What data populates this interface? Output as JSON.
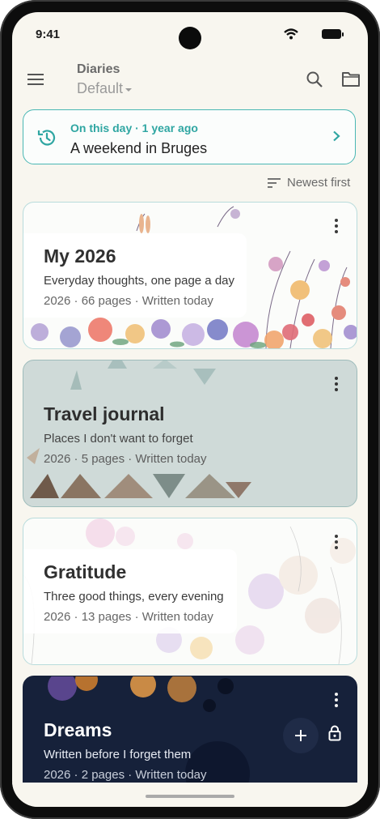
{
  "status_bar": {
    "time": "9:41"
  },
  "top_bar": {
    "label": "Diaries",
    "selected_collection": "Default"
  },
  "on_this_day": {
    "kicker": "On this day · 1 year ago",
    "title": "A weekend in Bruges"
  },
  "sort": {
    "label": "Newest first"
  },
  "diaries": [
    {
      "title": "My 2026",
      "description": "Everyday thoughts, one page a day",
      "meta": "2026 · 66 pages · Written today",
      "theme": "floral"
    },
    {
      "title": "Travel journal",
      "description": "Places I don't want to forget",
      "meta": "2026 · 5 pages · Written today",
      "theme": "geometric"
    },
    {
      "title": "Gratitude",
      "description": "Three good things, every evening",
      "meta": "2026 · 13 pages · Written today",
      "theme": "watercolor"
    },
    {
      "title": "Dreams",
      "description": "Written before I forget them",
      "meta": "2026 · 2 pages · Written today",
      "theme": "space",
      "locked": true
    }
  ],
  "icons": {
    "menu": "menu-icon",
    "search": "search-icon",
    "folder": "folder-icon",
    "history": "history-icon",
    "chevron": "chevron-right-icon",
    "sort": "sort-icon",
    "more": "more-vertical-icon",
    "add": "plus-icon",
    "lock": "lock-icon"
  },
  "colors": {
    "accent": "#2fa6a2",
    "background": "#f8f6ef",
    "dark_card": "#16213a"
  }
}
